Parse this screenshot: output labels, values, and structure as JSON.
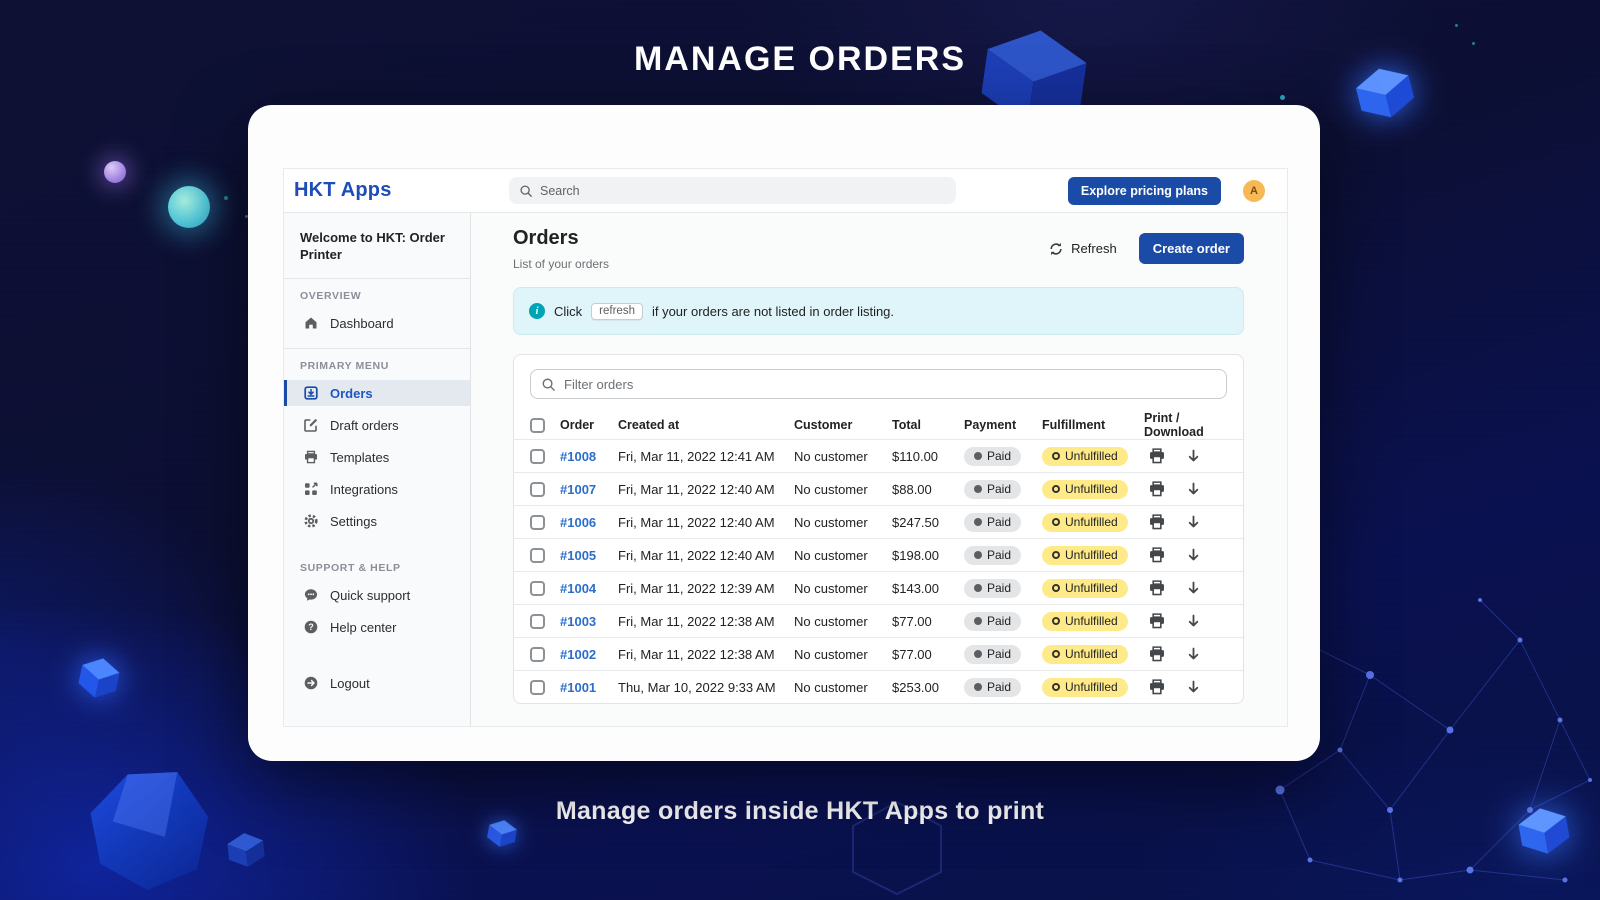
{
  "hero": {
    "title": "MANAGE ORDERS",
    "caption": "Manage orders inside HKT Apps to print"
  },
  "header": {
    "logo": "HKT Apps",
    "search_placeholder": "Search",
    "pricing_button": "Explore pricing plans",
    "avatar": "A"
  },
  "sidebar": {
    "welcome": "Welcome to HKT: Order Printer",
    "overview_header": "OVERVIEW",
    "dashboard": "Dashboard",
    "primary_header": "PRIMARY MENU",
    "orders": "Orders",
    "draft_orders": "Draft orders",
    "templates": "Templates",
    "integrations": "Integrations",
    "settings": "Settings",
    "support_header": "SUPPORT & HELP",
    "quick_support": "Quick support",
    "help_center": "Help center",
    "logout": "Logout"
  },
  "page": {
    "title": "Orders",
    "subtitle": "List of your orders",
    "refresh": "Refresh",
    "create_order": "Create order"
  },
  "banner": {
    "before": "Click",
    "chip": "refresh",
    "after": "if your orders are not listed in order listing."
  },
  "filter": {
    "placeholder": "Filter orders"
  },
  "table": {
    "columns": {
      "order": "Order",
      "created": "Created at",
      "customer": "Customer",
      "total": "Total",
      "payment": "Payment",
      "fulfillment": "Fulfillment",
      "print": "Print / Download"
    },
    "rows": [
      {
        "order": "#1008",
        "created": "Fri, Mar 11, 2022 12:41 AM",
        "customer": "No customer",
        "total": "$110.00",
        "payment": "Paid",
        "fulfillment": "Unfulfilled"
      },
      {
        "order": "#1007",
        "created": "Fri, Mar 11, 2022 12:40 AM",
        "customer": "No customer",
        "total": "$88.00",
        "payment": "Paid",
        "fulfillment": "Unfulfilled"
      },
      {
        "order": "#1006",
        "created": "Fri, Mar 11, 2022 12:40 AM",
        "customer": "No customer",
        "total": "$247.50",
        "payment": "Paid",
        "fulfillment": "Unfulfilled"
      },
      {
        "order": "#1005",
        "created": "Fri, Mar 11, 2022 12:40 AM",
        "customer": "No customer",
        "total": "$198.00",
        "payment": "Paid",
        "fulfillment": "Unfulfilled"
      },
      {
        "order": "#1004",
        "created": "Fri, Mar 11, 2022 12:39 AM",
        "customer": "No customer",
        "total": "$143.00",
        "payment": "Paid",
        "fulfillment": "Unfulfilled"
      },
      {
        "order": "#1003",
        "created": "Fri, Mar 11, 2022 12:38 AM",
        "customer": "No customer",
        "total": "$77.00",
        "payment": "Paid",
        "fulfillment": "Unfulfilled"
      },
      {
        "order": "#1002",
        "created": "Fri, Mar 11, 2022 12:38 AM",
        "customer": "No customer",
        "total": "$77.00",
        "payment": "Paid",
        "fulfillment": "Unfulfilled"
      },
      {
        "order": "#1001",
        "created": "Thu, Mar 10, 2022 9:33 AM",
        "customer": "No customer",
        "total": "$253.00",
        "payment": "Paid",
        "fulfillment": "Unfulfilled"
      }
    ]
  },
  "colors": {
    "accent_blue": "#1a4ba6",
    "logo_blue": "#1e4db8",
    "link_blue": "#2c6ecb",
    "paid_badge_bg": "#e4e5e7",
    "unfulfilled_badge_bg": "#ffea8a",
    "banner_bg": "#e0f5f9",
    "banner_icon": "#00a5b5",
    "avatar_bg": "#f6b955",
    "background_navy": "#0c0f33",
    "background_bright_blue": "#0a18a0"
  }
}
